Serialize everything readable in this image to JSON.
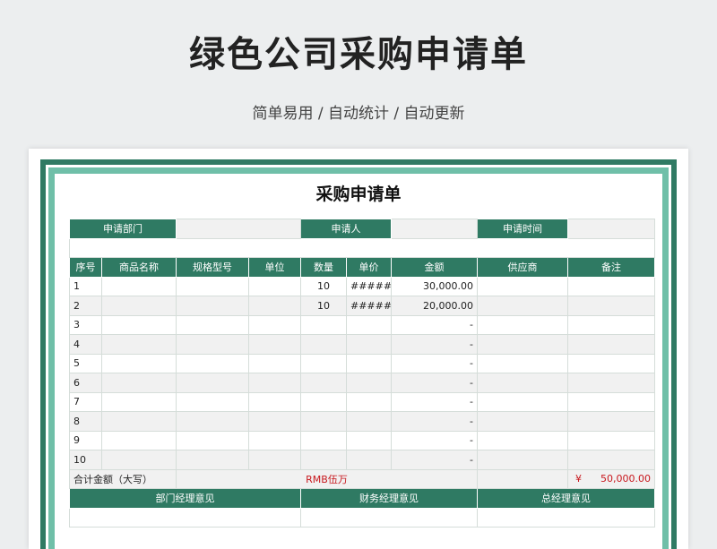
{
  "page": {
    "title": "绿色公司采购申请单",
    "subtitle": "简单易用 / 自动统计 / 自动更新"
  },
  "sheet": {
    "title": "采购申请单",
    "info_labels": [
      "申请部门",
      "申请人",
      "申请时间"
    ],
    "columns": [
      "序号",
      "商品名称",
      "规格型号",
      "单位",
      "数量",
      "单价",
      "金额",
      "供应商",
      "备注"
    ],
    "rows": [
      {
        "no": "1",
        "name": "",
        "spec": "",
        "unit": "",
        "qty": "10",
        "price": "######",
        "amount": "30,000.00",
        "supplier": "",
        "note": ""
      },
      {
        "no": "2",
        "name": "",
        "spec": "",
        "unit": "",
        "qty": "10",
        "price": "######",
        "amount": "20,000.00",
        "supplier": "",
        "note": ""
      },
      {
        "no": "3",
        "name": "",
        "spec": "",
        "unit": "",
        "qty": "",
        "price": "",
        "amount": "-",
        "supplier": "",
        "note": ""
      },
      {
        "no": "4",
        "name": "",
        "spec": "",
        "unit": "",
        "qty": "",
        "price": "",
        "amount": "-",
        "supplier": "",
        "note": ""
      },
      {
        "no": "5",
        "name": "",
        "spec": "",
        "unit": "",
        "qty": "",
        "price": "",
        "amount": "-",
        "supplier": "",
        "note": ""
      },
      {
        "no": "6",
        "name": "",
        "spec": "",
        "unit": "",
        "qty": "",
        "price": "",
        "amount": "-",
        "supplier": "",
        "note": ""
      },
      {
        "no": "7",
        "name": "",
        "spec": "",
        "unit": "",
        "qty": "",
        "price": "",
        "amount": "-",
        "supplier": "",
        "note": ""
      },
      {
        "no": "8",
        "name": "",
        "spec": "",
        "unit": "",
        "qty": "",
        "price": "",
        "amount": "-",
        "supplier": "",
        "note": ""
      },
      {
        "no": "9",
        "name": "",
        "spec": "",
        "unit": "",
        "qty": "",
        "price": "",
        "amount": "-",
        "supplier": "",
        "note": ""
      },
      {
        "no": "10",
        "name": "",
        "spec": "",
        "unit": "",
        "qty": "",
        "price": "",
        "amount": "-",
        "supplier": "",
        "note": ""
      }
    ],
    "total": {
      "label": "合计金额（大写）",
      "capital": "RMB伍万",
      "currency": "¥",
      "amount": "50,000.00"
    },
    "opinions": [
      "部门经理意见",
      "财务经理意见",
      "总经理意见"
    ]
  },
  "colors": {
    "header_green": "#2f7a63",
    "frame_light_green": "#6fbfa8",
    "total_red": "#c8181e"
  }
}
